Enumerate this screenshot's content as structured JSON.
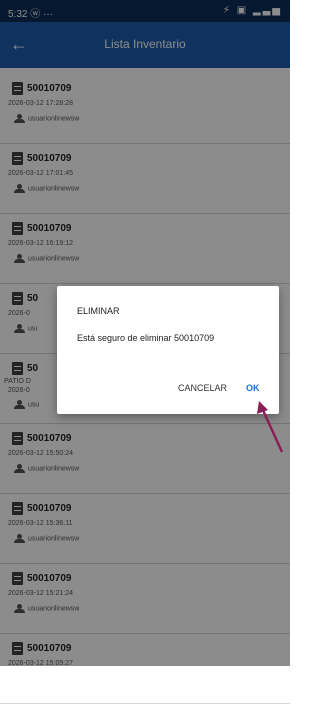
{
  "status_bar": {
    "time": "5:32 ⓦ  ···",
    "icons": "⚡ ▣ ▂▃▅"
  },
  "app_bar": {
    "back_icon": "←",
    "title": "Lista Inventario"
  },
  "items": [
    {
      "code": "50010709",
      "date": "2026-03-12 17:28:28",
      "user": "usuarionlinewsw"
    },
    {
      "code": "50010709",
      "date": "2026-03-12 17:01:45",
      "user": "usuarionlinewsw"
    },
    {
      "code": "50010709",
      "date": "2026-03-12 16:19:12",
      "user": "usuarionlinewsw"
    },
    {
      "code": "50",
      "date": "2026-0",
      "user": "usı"
    },
    {
      "code": "50",
      "extra": "PATIO D",
      "date": "2026-0",
      "user": "usu"
    },
    {
      "code": "50010709",
      "date": "2026-03-12 15:50:24",
      "user": "usuarionlinewsw"
    },
    {
      "code": "50010709",
      "date": "2026-03-12 15:36:11",
      "user": "usuarionlinewsw"
    },
    {
      "code": "50010709",
      "date": "2026-03-12 15:21:24",
      "user": "usuarionlinewsw"
    },
    {
      "code": "50010709",
      "date": "2026-03-12 15:09:27",
      "user": ""
    }
  ],
  "dialog": {
    "title": "ELIMINAR",
    "message": "Está seguro de eliminar 50010709",
    "cancel_label": "CANCELAR",
    "ok_label": "OK"
  },
  "colors": {
    "app_bar": "#1e5cab",
    "status_bar": "#0d2f5a",
    "ok": "#1e6fcf",
    "annotation_arrow": "#8a1f55"
  }
}
